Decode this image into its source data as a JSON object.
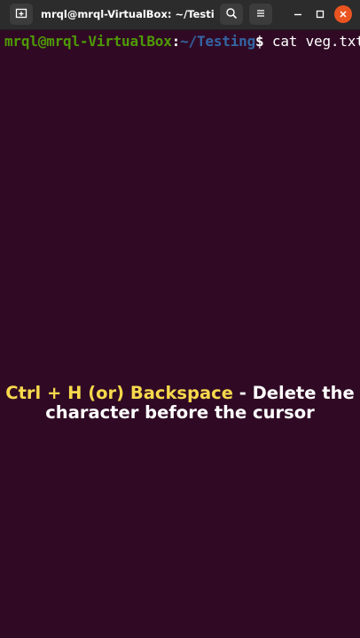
{
  "window": {
    "title": "mrql@mrql-VirtualBox: ~/Testing",
    "buttons": {
      "new_tab_icon": "new-tab-icon",
      "search_icon": "search-icon",
      "menu_icon": "hamburger-menu-icon",
      "minimize_icon": "minimize-icon",
      "maximize_icon": "maximize-icon",
      "close_icon": "close-icon"
    }
  },
  "terminal": {
    "prompt_user": "mrql@mrql-VirtualBox",
    "prompt_colon": ":",
    "prompt_path": "~/Testing",
    "prompt_dollar": "$",
    "command": " cat veg.txt",
    "colors": {
      "background": "#300a24",
      "user": "#4e9a06",
      "path": "#3465a4",
      "text": "#ffffff"
    }
  },
  "caption": {
    "highlight": "Ctrl + H (or) Backspace",
    "rest_line1": " - Delete the",
    "line2": "character before the cursor",
    "highlight_color": "#f7d94c"
  }
}
